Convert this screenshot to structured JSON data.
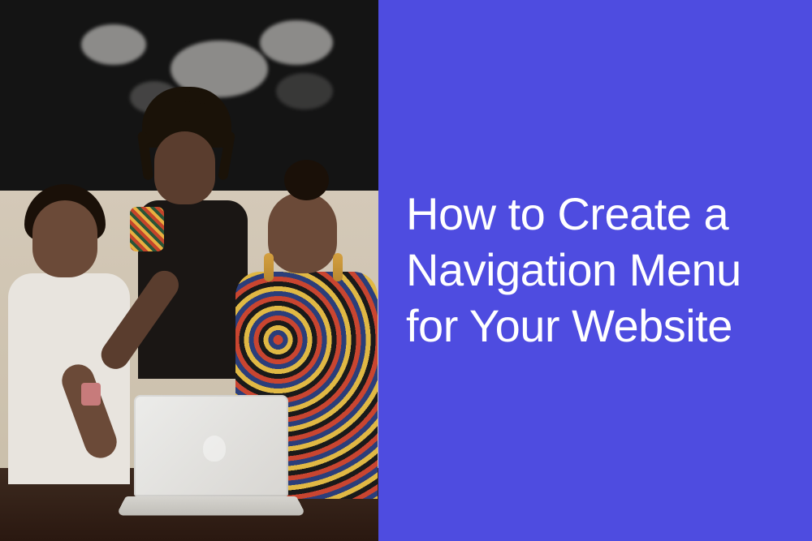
{
  "title": "How to Create a Navigation Menu for Your Website",
  "colors": {
    "panel_bg": "#4e4ce0",
    "title_text": "#ffffff"
  },
  "image_description": "Three women collaborating around a laptop, smiling, with a dark textured wall backdrop"
}
